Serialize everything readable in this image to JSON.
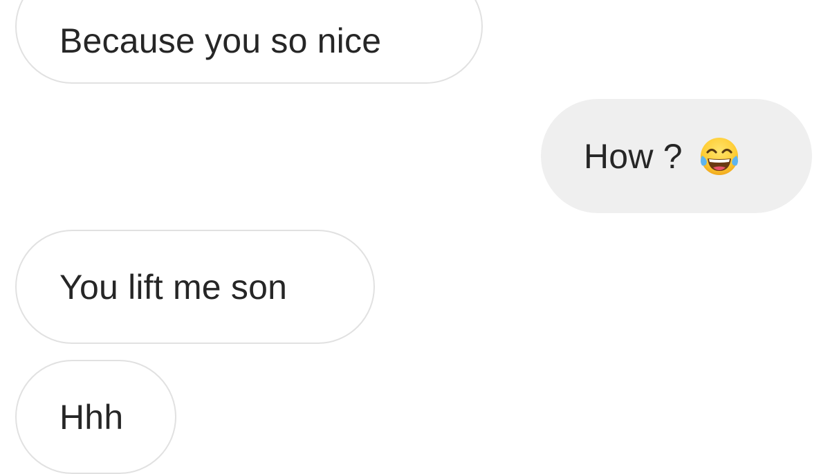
{
  "conversation": {
    "messages": [
      {
        "sender": "other",
        "text": "Because you so nice"
      },
      {
        "sender": "me",
        "text": "How ?",
        "emoji": "face-with-tears-of-joy-icon"
      },
      {
        "sender": "other",
        "text": "You lift me son"
      },
      {
        "sender": "other",
        "text": "Hhh"
      }
    ]
  },
  "colors": {
    "received_bubble_bg": "#ffffff",
    "received_bubble_border": "#e1e1e1",
    "sent_bubble_bg": "#efefef",
    "text": "#262626",
    "emoji_face": "#ffcc33"
  }
}
